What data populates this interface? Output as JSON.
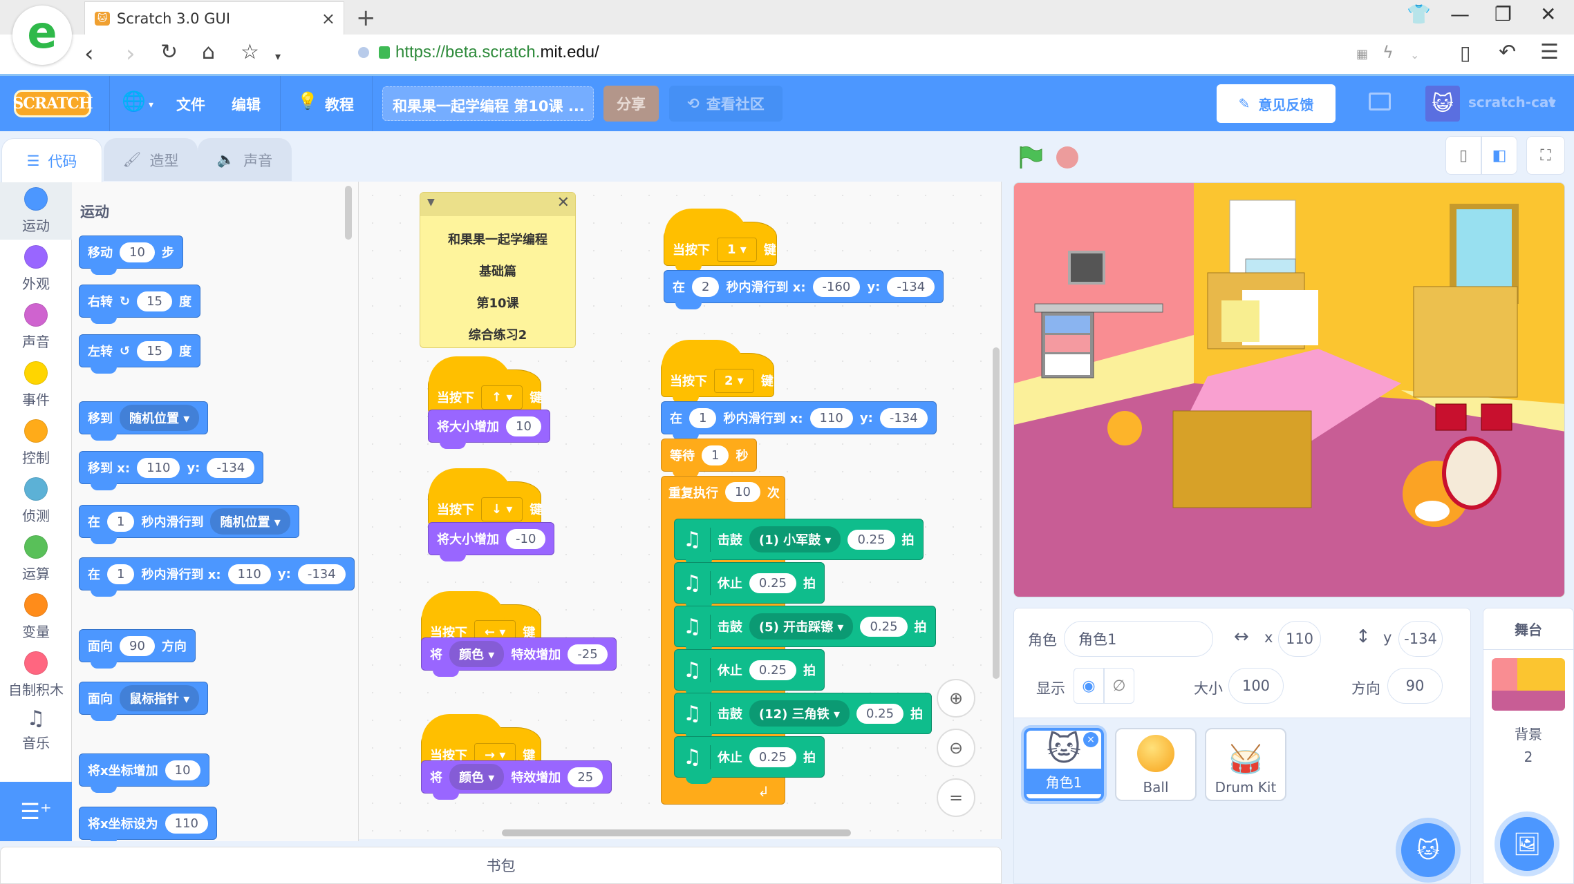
{
  "browser": {
    "tab_title": "Scratch 3.0 GUI",
    "url_scheme_path": "https://beta.scratch.",
    "url_host": "mit.edu",
    "url_tail": "/",
    "icons": [
      "back-icon",
      "forward-icon",
      "reload-icon",
      "home-icon",
      "star-icon",
      "qr-icon",
      "lightning-icon",
      "tablet-icon",
      "undo-icon",
      "menu-icon",
      "skin-icon",
      "minimize-icon",
      "restore-icon",
      "close-icon"
    ]
  },
  "menubar": {
    "logo": "SCRATCH",
    "file": "文件",
    "edit": "编辑",
    "tutorials": "教程",
    "project_title": "和果果一起学编程 第10课 ...",
    "share": "分享",
    "see_community": "查看社区",
    "feedback": "意见反馈",
    "username": "scratch-cat"
  },
  "editor_tabs": [
    {
      "label": "代码",
      "active": true
    },
    {
      "label": "造型",
      "active": false
    },
    {
      "label": "声音",
      "active": false
    }
  ],
  "categories": [
    {
      "label": "运动",
      "color": "#4c97ff"
    },
    {
      "label": "外观",
      "color": "#9966ff"
    },
    {
      "label": "声音",
      "color": "#cf63cf"
    },
    {
      "label": "事件",
      "color": "#ffd500"
    },
    {
      "label": "控制",
      "color": "#ffab19"
    },
    {
      "label": "侦测",
      "color": "#5cb1d6"
    },
    {
      "label": "运算",
      "color": "#59c059"
    },
    {
      "label": "变量",
      "color": "#ff8c1a"
    },
    {
      "label": "自制积木",
      "color": "#ff6680"
    },
    {
      "label": "音乐",
      "color": ""
    }
  ],
  "palette": {
    "title": "运动",
    "move": {
      "pre": "移动",
      "val": "10",
      "post": "步"
    },
    "turn_right": {
      "pre": "右转",
      "val": "15",
      "post": "度"
    },
    "turn_left": {
      "pre": "左转",
      "val": "15",
      "post": "度"
    },
    "goto": {
      "pre": "移到",
      "dd": "随机位置"
    },
    "goto_xy": {
      "pre": "移到 x:",
      "x": "110",
      "ylab": "y:",
      "y": "-134"
    },
    "glide": {
      "pre": "在",
      "val": "1",
      "mid": "秒内滑行到",
      "dd": "随机位置"
    },
    "glide_xy": {
      "pre": "在",
      "val": "1",
      "mid": "秒内滑行到 x:",
      "x": "110",
      "ylab": "y:",
      "y": "-134"
    },
    "point_dir": {
      "pre": "面向",
      "val": "90",
      "post": "方向"
    },
    "point_to": {
      "pre": "面向",
      "dd": "鼠标指针"
    },
    "change_x": {
      "pre": "将x坐标增加",
      "val": "10"
    },
    "set_x_partial": {
      "pre": "将x坐标设为",
      "val": "110"
    }
  },
  "comment": {
    "lines": [
      "和果果一起学编程",
      "基础篇",
      "第10课",
      "综合练习2"
    ]
  },
  "scripts": {
    "when_key": "当按下",
    "key_suffix": "键",
    "s_up": {
      "key": "↑",
      "action": "将大小增加",
      "val": "10"
    },
    "s_down": {
      "key": "↓",
      "action": "将大小增加",
      "val": "-10"
    },
    "s_left": {
      "key": "←",
      "pre": "将",
      "dd": "颜色",
      "action": "特效增加",
      "val": "-25"
    },
    "s_right": {
      "key": "→",
      "pre": "将",
      "dd": "颜色",
      "action": "特效增加",
      "val": "25"
    },
    "s_1": {
      "key": "1",
      "pre": "在",
      "secs": "2",
      "mid": "秒内滑行到 x:",
      "x": "-160",
      "ylab": "y:",
      "y": "-134"
    },
    "s_2": {
      "key": "2",
      "glide": {
        "pre": "在",
        "secs": "1",
        "mid": "秒内滑行到 x:",
        "x": "110",
        "ylab": "y:",
        "y": "-134"
      },
      "wait": {
        "pre": "等待",
        "val": "1",
        "post": "秒"
      },
      "repeat": {
        "pre": "重复执行",
        "val": "10",
        "post": "次"
      },
      "drum_label": "击鼓",
      "rest_label": "休止",
      "beats_label": "拍",
      "body": [
        {
          "type": "drum",
          "dd": "(1) 小军鼓",
          "val": "0.25"
        },
        {
          "type": "rest",
          "val": "0.25"
        },
        {
          "type": "drum",
          "dd": "(5) 开击踩镲",
          "val": "0.25"
        },
        {
          "type": "rest",
          "val": "0.25"
        },
        {
          "type": "drum",
          "dd": "(12) 三角铁",
          "val": "0.25"
        },
        {
          "type": "rest",
          "val": "0.25"
        }
      ]
    }
  },
  "backpack": "书包",
  "sprite_info": {
    "sprite_label": "角色",
    "sprite_name": "角色1",
    "x_label": "x",
    "x": "110",
    "y_label": "y",
    "y": "-134",
    "show_label": "显示",
    "size_label": "大小",
    "size": "100",
    "direction_label": "方向",
    "direction": "90"
  },
  "sprites": [
    {
      "name": "角色1",
      "selected": true
    },
    {
      "name": "Ball",
      "selected": false
    },
    {
      "name": "Drum Kit",
      "selected": false
    }
  ],
  "stage_pane": {
    "title": "舞台",
    "backdrops_label": "背景",
    "backdrops_count": "2"
  }
}
